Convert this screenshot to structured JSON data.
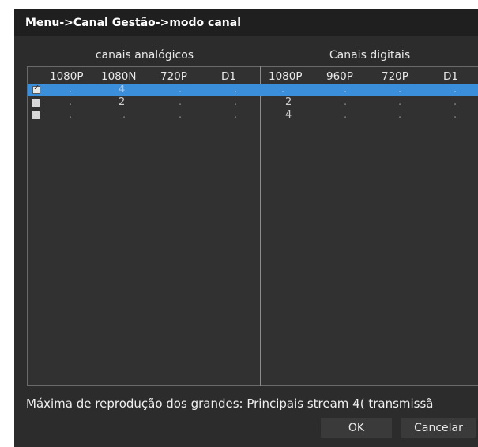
{
  "window": {
    "title": "Menu->Canal Gestão->modo canal"
  },
  "groups": {
    "analog": "canais analógicos",
    "digital": "Canais digitais"
  },
  "columns": {
    "analog": [
      "1080P",
      "1080N",
      "720P",
      "D1"
    ],
    "digital": [
      "1080P",
      "960P",
      "720P",
      "D1"
    ]
  },
  "rows": [
    {
      "checked": true,
      "selected": true,
      "analog": [
        ".",
        "4",
        ".",
        "."
      ],
      "digital": [
        ".",
        ".",
        ".",
        "."
      ]
    },
    {
      "checked": false,
      "selected": false,
      "analog": [
        ".",
        "2",
        ".",
        "."
      ],
      "digital": [
        "2",
        ".",
        ".",
        "."
      ]
    },
    {
      "checked": false,
      "selected": false,
      "analog": [
        ".",
        ".",
        ".",
        "."
      ],
      "digital": [
        "4",
        ".",
        ".",
        "."
      ]
    }
  ],
  "footer": {
    "text": "Máxima de reprodução dos grandes: Principais stream 4( transmissã",
    "ok_label": "OK",
    "cancel_label": "Cancelar"
  },
  "colors": {
    "window_bg": "#2c2c2c",
    "title_bg": "#1f1f1f",
    "selection": "#3b8ed9"
  }
}
